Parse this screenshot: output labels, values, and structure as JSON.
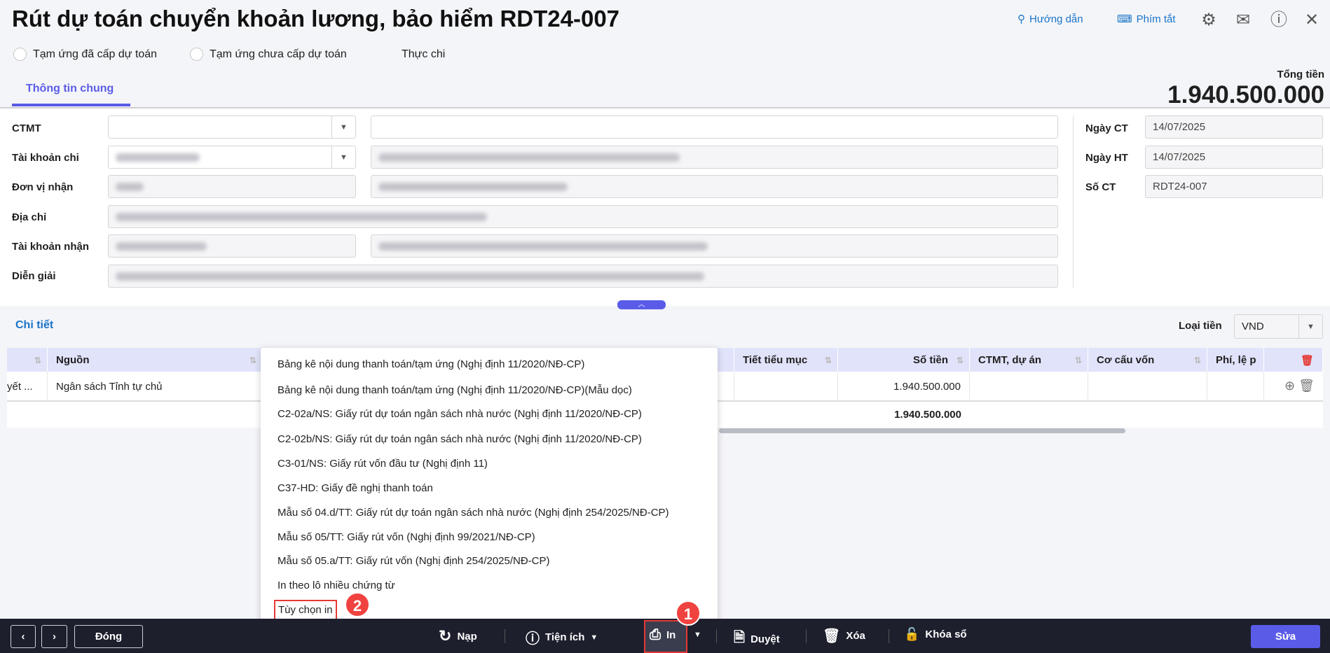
{
  "header": {
    "title": "Rút dự toán chuyển khoản lương, bảo hiểm RDT24-007",
    "guide": "Hướng dẫn",
    "shortcuts": "Phím tắt"
  },
  "radios": [
    {
      "label": "Tạm ứng đã cấp dự toán",
      "selected": false
    },
    {
      "label": "Tạm ứng chưa cấp dự toán",
      "selected": false
    },
    {
      "label": "Thực chi",
      "selected": true
    }
  ],
  "tabs": {
    "general": "Thông tin chung"
  },
  "total": {
    "label": "Tổng tiền",
    "value": "1.940.500.000"
  },
  "form": {
    "labels": [
      "CTMT",
      "Tài khoản chi",
      "Đơn vị nhận",
      "Địa chỉ",
      "Tài khoản nhận",
      "Diễn giải"
    ],
    "ngay_ct_label": "Ngày CT",
    "ngay_ct": "14/07/2025",
    "ngay_ht_label": "Ngày HT",
    "ngay_ht": "14/07/2025",
    "so_ct_label": "Số CT",
    "so_ct": "RDT24-007"
  },
  "detail": {
    "title": "Chi tiết",
    "currency_label": "Loại tiền",
    "currency": "VND"
  },
  "table": {
    "headers": {
      "nguon": "Nguồn",
      "tiet_tieu_muc": "Tiết tiểu mục",
      "so_tien": "Số tiền",
      "ctmt": "CTMT, dự án",
      "co_cau_von": "Cơ cấu vốn",
      "phi": "Phí, lệ p"
    },
    "row": {
      "first": "yết ...",
      "nguon": "Ngân sách Tỉnh tự chủ",
      "so_tien": "1.940.500.000"
    },
    "total": "1.940.500.000"
  },
  "print_menu": [
    "Bảng kê nội dung thanh toán/tạm ứng (Nghị định 11/2020/NĐ-CP)",
    "Bảng kê nội dung thanh toán/tạm ứng (Nghị định 11/2020/NĐ-CP)(Mẫu dọc)",
    "C2-02a/NS: Giấy rút dự toán ngân sách nhà nước (Nghị định 11/2020/NĐ-CP)",
    "C2-02b/NS: Giấy rút dự toán ngân sách nhà nước (Nghị định 11/2020/NĐ-CP)",
    "C3-01/NS: Giấy rút vốn đầu tư (Nghị định 11)",
    "C37-HD: Giấy đề nghị thanh toán",
    "Mẫu số 04.d/TT: Giấy rút dự toán ngân sách nhà nước (Nghị định 254/2025/NĐ-CP)",
    "Mẫu số 05/TT: Giấy rút vốn (Nghị định 99/2021/NĐ-CP)",
    "Mẫu số 05.a/TT: Giấy rút vốn (Nghị định 254/2025/NĐ-CP)",
    "In theo lô nhiều chứng từ",
    "Tùy chọn in"
  ],
  "footer": {
    "close": "Đóng",
    "reload": "Nạp",
    "utilities": "Tiện ích",
    "print": "In",
    "approve": "Duyệt",
    "delete": "Xóa",
    "lock": "Khóa sổ",
    "edit": "Sửa"
  },
  "badges": {
    "one": "1",
    "two": "2"
  },
  "colors": {
    "accent": "#5a5ce8",
    "link": "#1a73c9",
    "footer": "#1d1f2d",
    "badge": "#f0433f"
  }
}
